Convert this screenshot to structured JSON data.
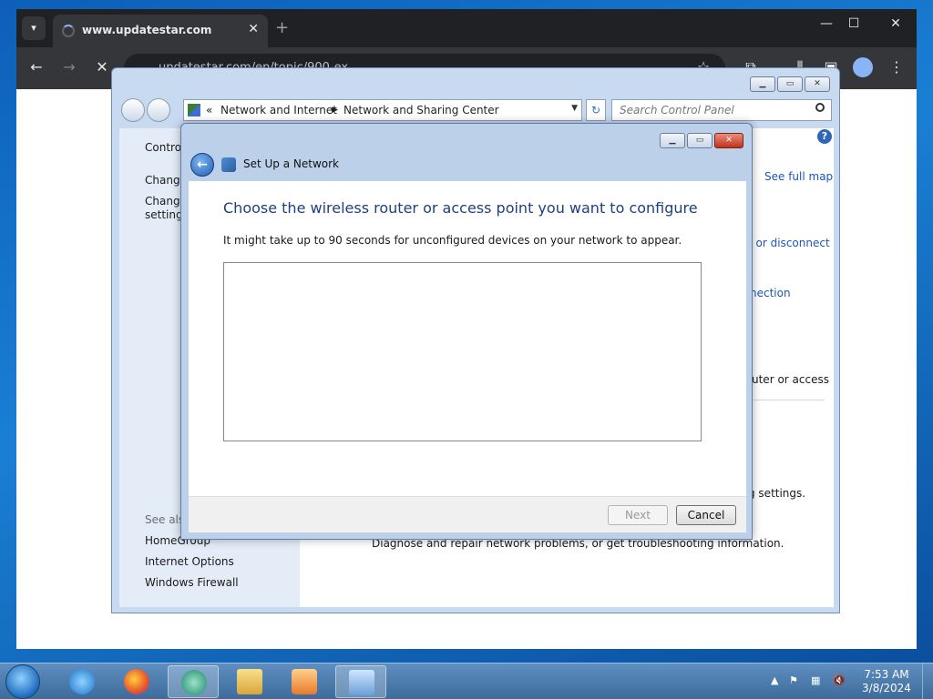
{
  "browser": {
    "tab_title": "www.updatestar.com",
    "url": "updatestar.com/en/topic/900-ex..."
  },
  "control_panel": {
    "breadcrumb_prefix": "«",
    "breadcrumb_1": "Network and Internet",
    "breadcrumb_2": "Network and Sharing Center",
    "search_placeholder": "Search Control Panel",
    "side": {
      "home": "Control",
      "item1": "Change",
      "item2a": "Change",
      "item2b": "settings",
      "see_also": "See also",
      "links": [
        "HomeGroup",
        "Internet Options",
        "Windows Firewall"
      ]
    },
    "main": {
      "see_full_map": "See full map",
      "connect_disconnect": "t or disconnect",
      "connection": "nection",
      "router_access": "uter or access",
      "settings": "g settings.",
      "troubleshoot": "Diagnose and repair network problems, or get troubleshooting information."
    }
  },
  "dialog": {
    "title": "Set Up a Network",
    "heading": "Choose the wireless router or access point you want to configure",
    "description": "It might take up to 90 seconds for unconfigured devices on your network to appear.",
    "next_label": "Next",
    "cancel_label": "Cancel"
  },
  "taskbar": {
    "time": "7:53 AM",
    "date": "3/8/2024"
  },
  "colors": {
    "dialog_heading": "#1f3f7f",
    "link": "#1a56b5",
    "aero_frame": "#bcd0ea"
  }
}
